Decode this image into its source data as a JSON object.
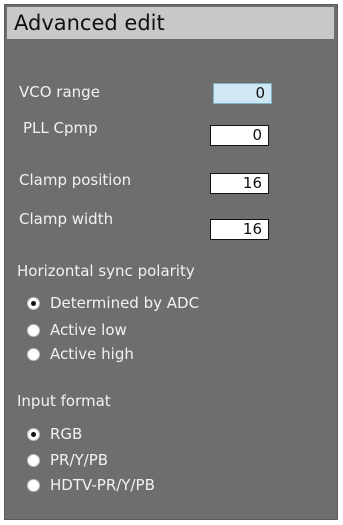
{
  "panel": {
    "title": "Advanced edit",
    "fields": [
      {
        "label": "VCO range",
        "value": "0",
        "active": true
      },
      {
        "label": "PLL Cpmp",
        "value": "0",
        "active": false
      },
      {
        "label": "Clamp position",
        "value": "16",
        "active": false
      },
      {
        "label": "Clamp width",
        "value": "16",
        "active": false
      }
    ],
    "sync_polarity": {
      "label": "Horizontal sync polarity",
      "options": [
        {
          "label": "Determined by ADC",
          "selected": true
        },
        {
          "label": "Active low",
          "selected": false
        },
        {
          "label": "Active high",
          "selected": false
        }
      ]
    },
    "input_format": {
      "label": "Input format",
      "options": [
        {
          "label": "RGB",
          "selected": true
        },
        {
          "label": "PR/Y/PB",
          "selected": false
        },
        {
          "label": "HDTV-PR/Y/PB",
          "selected": false
        }
      ]
    }
  },
  "colors": {
    "panel_background": "#6e6e6e",
    "title_bar": "#c8c8c8",
    "active_field": "#cfe8f3"
  }
}
